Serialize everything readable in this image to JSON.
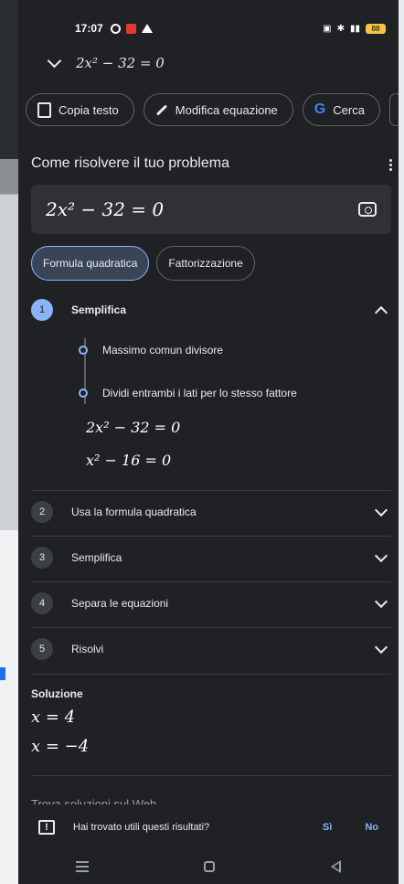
{
  "status_bar": {
    "time": "17:07",
    "battery": "88"
  },
  "header": {
    "equation": "2x² − 32 = 0"
  },
  "chips": [
    {
      "label": "Copia testo"
    },
    {
      "label": "Modifica equazione"
    },
    {
      "label": "Cerca"
    }
  ],
  "main": {
    "title": "Come risolvere il tuo problema",
    "equation": "2x² − 32 = 0"
  },
  "methods": [
    {
      "label": "Formula quadratica",
      "active": true
    },
    {
      "label": "Fattorizzazione",
      "active": false
    }
  ],
  "step1": {
    "number": "1",
    "label": "Semplifica",
    "substeps": [
      "Massimo comun divisore",
      "Dividi entrambi i lati per lo stesso fattore"
    ],
    "lines": [
      "2x² − 32 = 0",
      "x² − 16 = 0"
    ]
  },
  "steps": [
    {
      "number": "2",
      "label": "Usa la formula quadratica"
    },
    {
      "number": "3",
      "label": "Semplifica"
    },
    {
      "number": "4",
      "label": "Separa le equazioni"
    },
    {
      "number": "5",
      "label": "Risolvi"
    }
  ],
  "solution": {
    "label": "Soluzione",
    "values": [
      "x = 4",
      "x = −4"
    ]
  },
  "cutoff_text": "Trova soluzioni sul Web",
  "feedback": {
    "question": "Hai trovato utili questi risultati?",
    "yes": "Sì",
    "no": "No"
  },
  "colors": {
    "background": "#202124",
    "accent": "#8ab4f8",
    "surface": "#303134"
  }
}
